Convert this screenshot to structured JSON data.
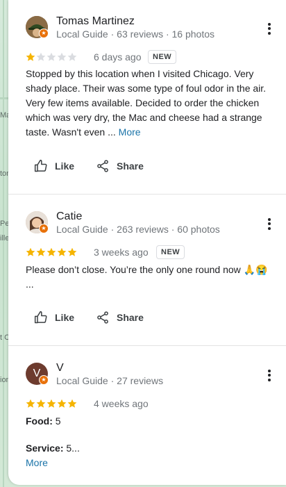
{
  "map": {
    "labels": [
      "Ma",
      "ton",
      "Pe",
      "ille",
      "t C",
      "ion"
    ]
  },
  "reviews": [
    {
      "name": "Tomas Martinez",
      "meta": "Local Guide · 63 reviews · 16 photos",
      "rating": 1,
      "time": "6 days ago",
      "badge": "NEW",
      "text": "Stopped by this location when I visited Chicago. Very shady place. Their was some type of foul odor in the air. Very few items available. Decided to order the chicken which was very dry, the Mac and cheese had a strange taste. Wasn't even ...",
      "more": "More",
      "like": "Like",
      "share": "Share",
      "avatar_color": "#7a5c3a"
    },
    {
      "name": "Catie",
      "meta": "Local Guide · 263 reviews · 60 photos",
      "rating": 5,
      "time": "3 weeks ago",
      "badge": "NEW",
      "text": "Please don’t close. You’re the only one round now 🙏😭",
      "ellipsis": "...",
      "like": "Like",
      "share": "Share",
      "avatar_color": "#c9a27e"
    },
    {
      "name": "V",
      "initial": "V",
      "meta": "Local Guide · 27 reviews",
      "rating": 5,
      "time": "4 weeks ago",
      "food_label": "Food:",
      "food_value": "5",
      "service_label": "Service:",
      "service_value": "5...",
      "more": "More",
      "avatar_color": "#6d3b2e"
    }
  ],
  "colors": {
    "star_filled": "#f5b400",
    "star_empty": "#dadce0",
    "link": "#1a73a8",
    "badge": "#e8710a"
  }
}
